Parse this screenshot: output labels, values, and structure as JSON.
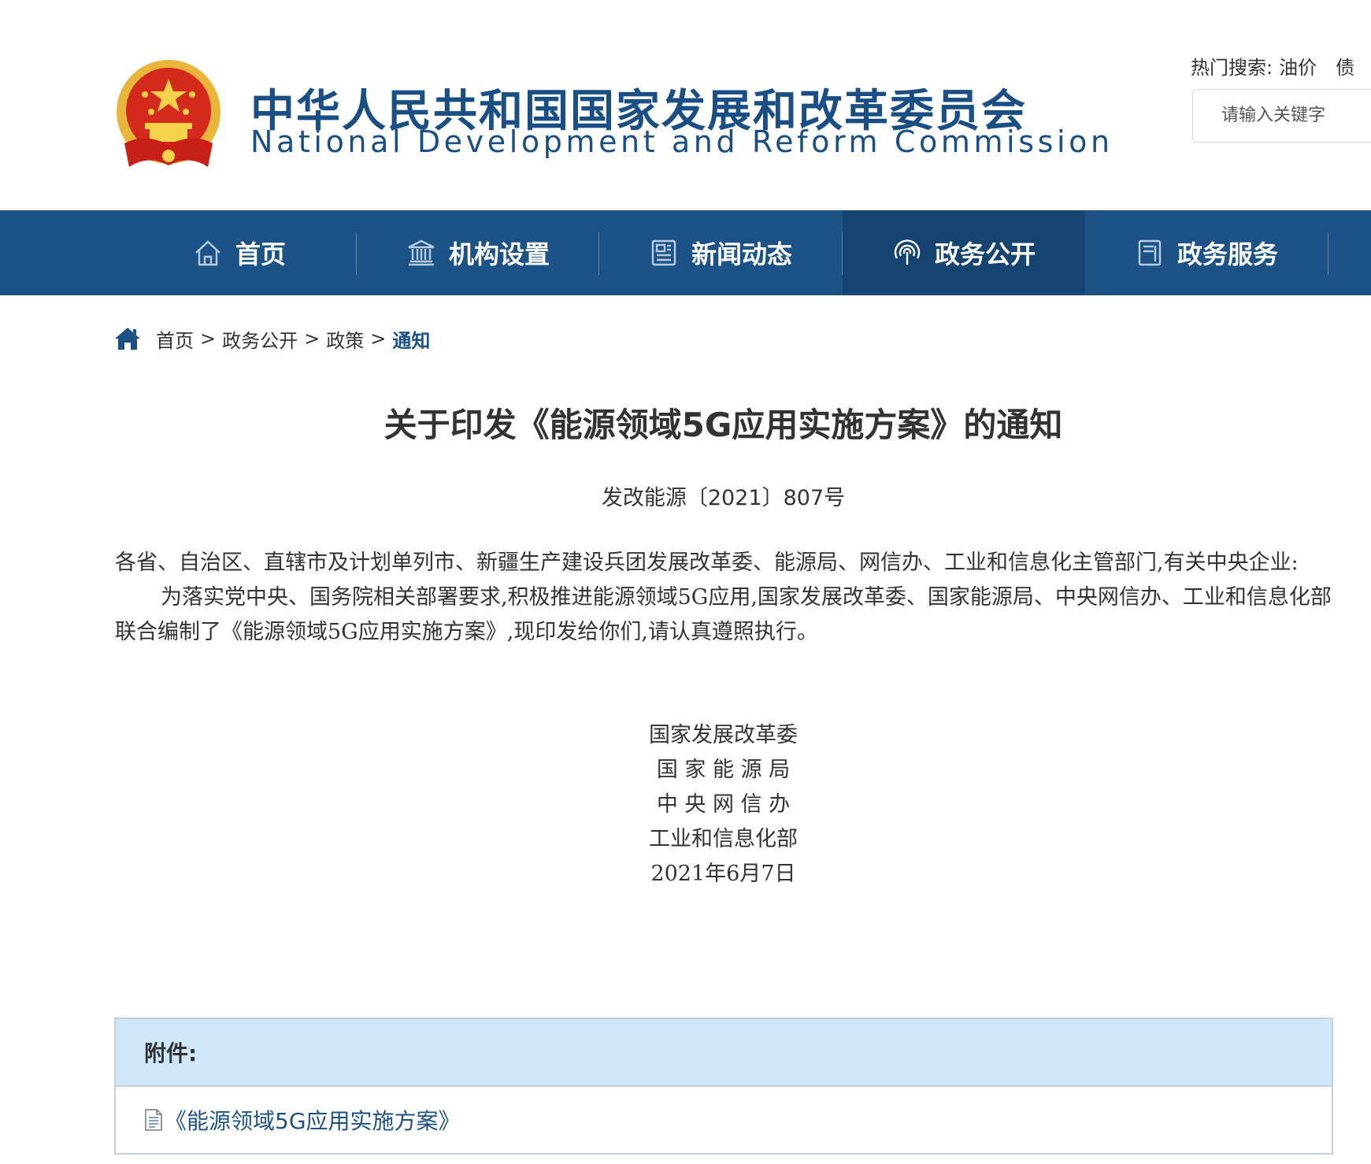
{
  "header": {
    "title_cn": "中华人民共和国国家发展和改革委员会",
    "title_en": "National Development and Reform Commission",
    "hot_search_label": "热门搜索:",
    "hot_search_keywords": [
      "油价",
      "债"
    ],
    "search_placeholder": "请输入关键字",
    "emblem_icon": "national-emblem-icon"
  },
  "nav": {
    "items": [
      {
        "label": "首页",
        "icon": "home-icon"
      },
      {
        "label": "机构设置",
        "icon": "institution-icon"
      },
      {
        "label": "新闻动态",
        "icon": "news-icon"
      },
      {
        "label": "政务公开",
        "icon": "broadcast-icon",
        "active": true
      },
      {
        "label": "政务服务",
        "icon": "service-doc-icon"
      }
    ]
  },
  "breadcrumb": {
    "items": [
      "首页",
      "政务公开",
      "政策"
    ],
    "separator": ">",
    "current": "通知"
  },
  "article": {
    "title": "关于印发《能源领域5G应用实施方案》的通知",
    "doc_number": "发改能源〔2021〕807号",
    "recipients": "各省、自治区、直辖市及计划单列市、新疆生产建设兵团发展改革委、能源局、网信办、工业和信息化主管部门,有关中央企业:",
    "body": "为落实党中央、国务院相关部署要求,积极推进能源领域5G应用,国家发展改革委、国家能源局、中央网信办、工业和信息化部联合编制了《能源领域5G应用实施方案》,现印发给你们,请认真遵照执行。",
    "signatories": [
      "国家发展改革委",
      "国 家 能 源 局",
      "中 央 网 信 办",
      "工业和信息化部"
    ],
    "date": "2021年6月7日"
  },
  "attachments": {
    "header": "附件:",
    "items": [
      "《能源领域5G应用实施方案》"
    ]
  },
  "colors": {
    "brand_blue": "#1d5287",
    "nav_active": "#164470",
    "attach_header_bg": "#cde6fa"
  }
}
